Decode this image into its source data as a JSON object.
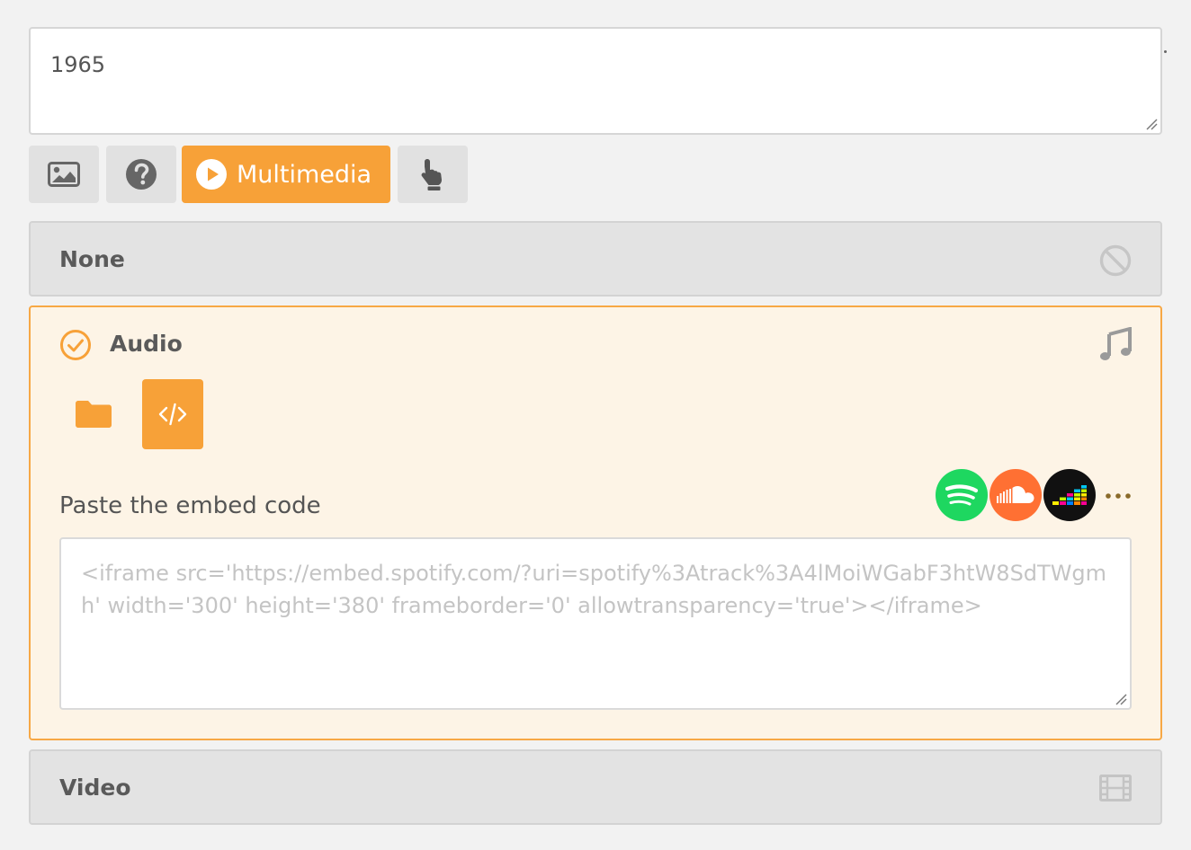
{
  "answer": {
    "value": "1965"
  },
  "toolbar": {
    "image_icon": "image-icon",
    "help_icon": "question-circle-icon",
    "multimedia_label": "Multimedia",
    "multimedia_icon": "play-circle-icon",
    "interaction_icon": "pointing-hand-icon"
  },
  "panels": {
    "none": {
      "title": "None",
      "icon": "ban-icon"
    },
    "audio": {
      "title": "Audio",
      "status_icon": "check-circle-icon",
      "type_icon": "music-note-icon",
      "sources": [
        {
          "icon": "folder-icon",
          "active": false
        },
        {
          "icon": "code-icon",
          "active": true
        }
      ],
      "embed_label": "Paste the embed code",
      "services": [
        "spotify-logo-icon",
        "soundcloud-logo-icon",
        "deezer-logo-icon",
        "more-dots-icon"
      ],
      "embed_placeholder": "<iframe src='https://embed.spotify.com/?uri=spotify%3Atrack%3A4lMoiWGabF3htW8SdTWgmh' width='300' height='380' frameborder='0' allowtransparency='true'></iframe>"
    },
    "video": {
      "title": "Video",
      "icon": "film-icon"
    }
  },
  "colors": {
    "accent": "#f7a138",
    "spotify": "#1ed760",
    "soundcloud": "#ff7033",
    "deezer": "#111111"
  }
}
